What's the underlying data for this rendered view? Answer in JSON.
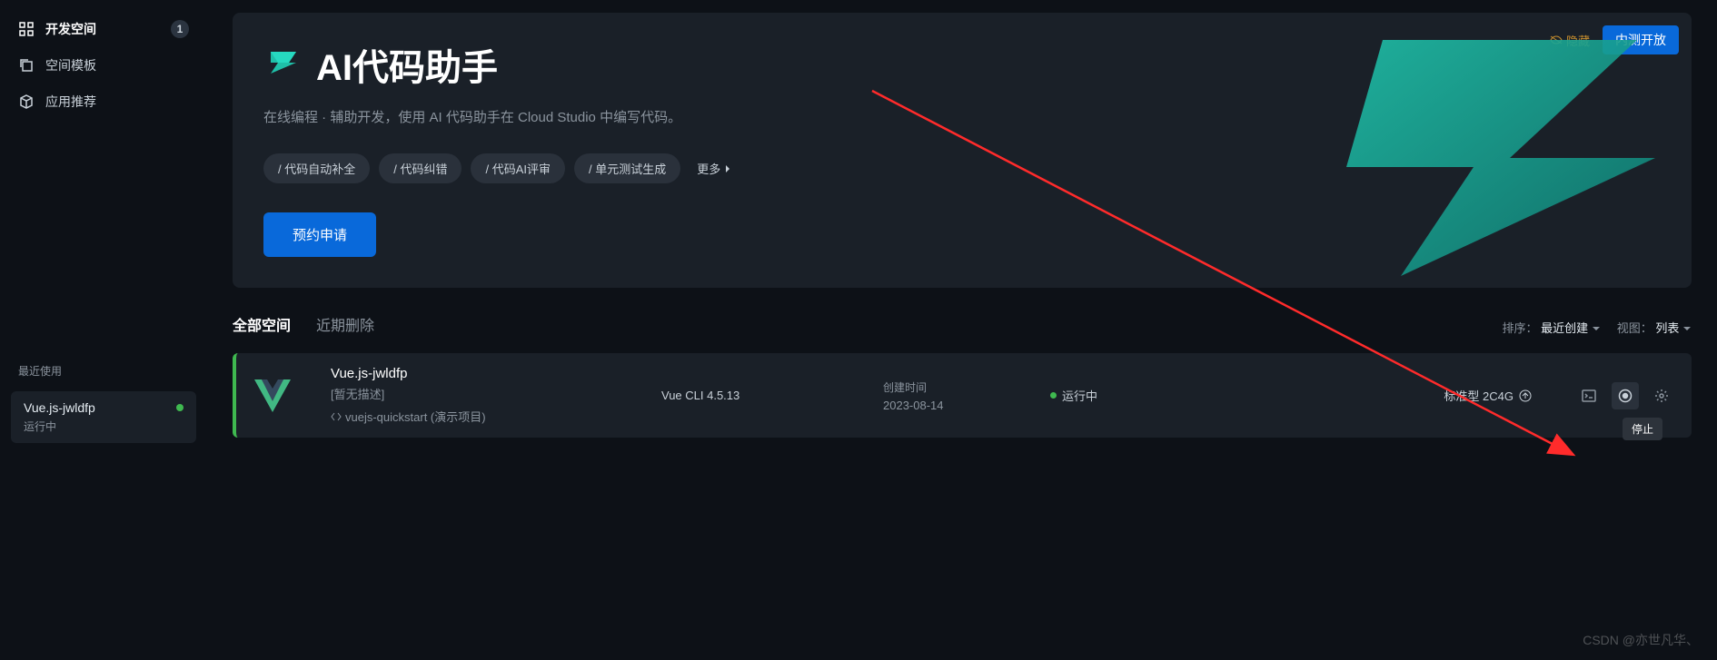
{
  "sidebar": {
    "items": [
      {
        "label": "开发空间",
        "badge": "1",
        "active": true,
        "icon": "grid-icon"
      },
      {
        "label": "空间模板",
        "active": false,
        "icon": "copy-icon"
      },
      {
        "label": "应用推荐",
        "active": false,
        "icon": "cube-icon"
      }
    ],
    "recent_title": "最近使用",
    "recent": {
      "name": "Vue.js-jwldfp",
      "status": "运行中"
    }
  },
  "banner": {
    "title": "AI代码助手",
    "subtitle": "在线编程 · 辅助开发，使用 AI 代码助手在 Cloud Studio 中编写代码。",
    "pills": [
      "/ 代码自动补全",
      "/ 代码纠错",
      "/ 代码AI评审",
      "/ 单元测试生成"
    ],
    "more": "更多",
    "reserve": "预约申请",
    "hide": "隐藏",
    "beta": "内测开放"
  },
  "tabs": {
    "items": [
      "全部空间",
      "近期删除"
    ],
    "sort_label": "排序：",
    "sort_value": "最近创建",
    "view_label": "视图：",
    "view_value": "列表"
  },
  "workspace": {
    "name": "Vue.js-jwldfp",
    "desc": "[暂无描述]",
    "template": "vuejs-quickstart (演示项目)",
    "cli": "Vue CLI 4.5.13",
    "created_label": "创建时间",
    "created_date": "2023-08-14",
    "status": "运行中",
    "spec": "标准型 2C4G"
  },
  "tooltip": "停止",
  "watermark": "CSDN @亦世凡华、"
}
